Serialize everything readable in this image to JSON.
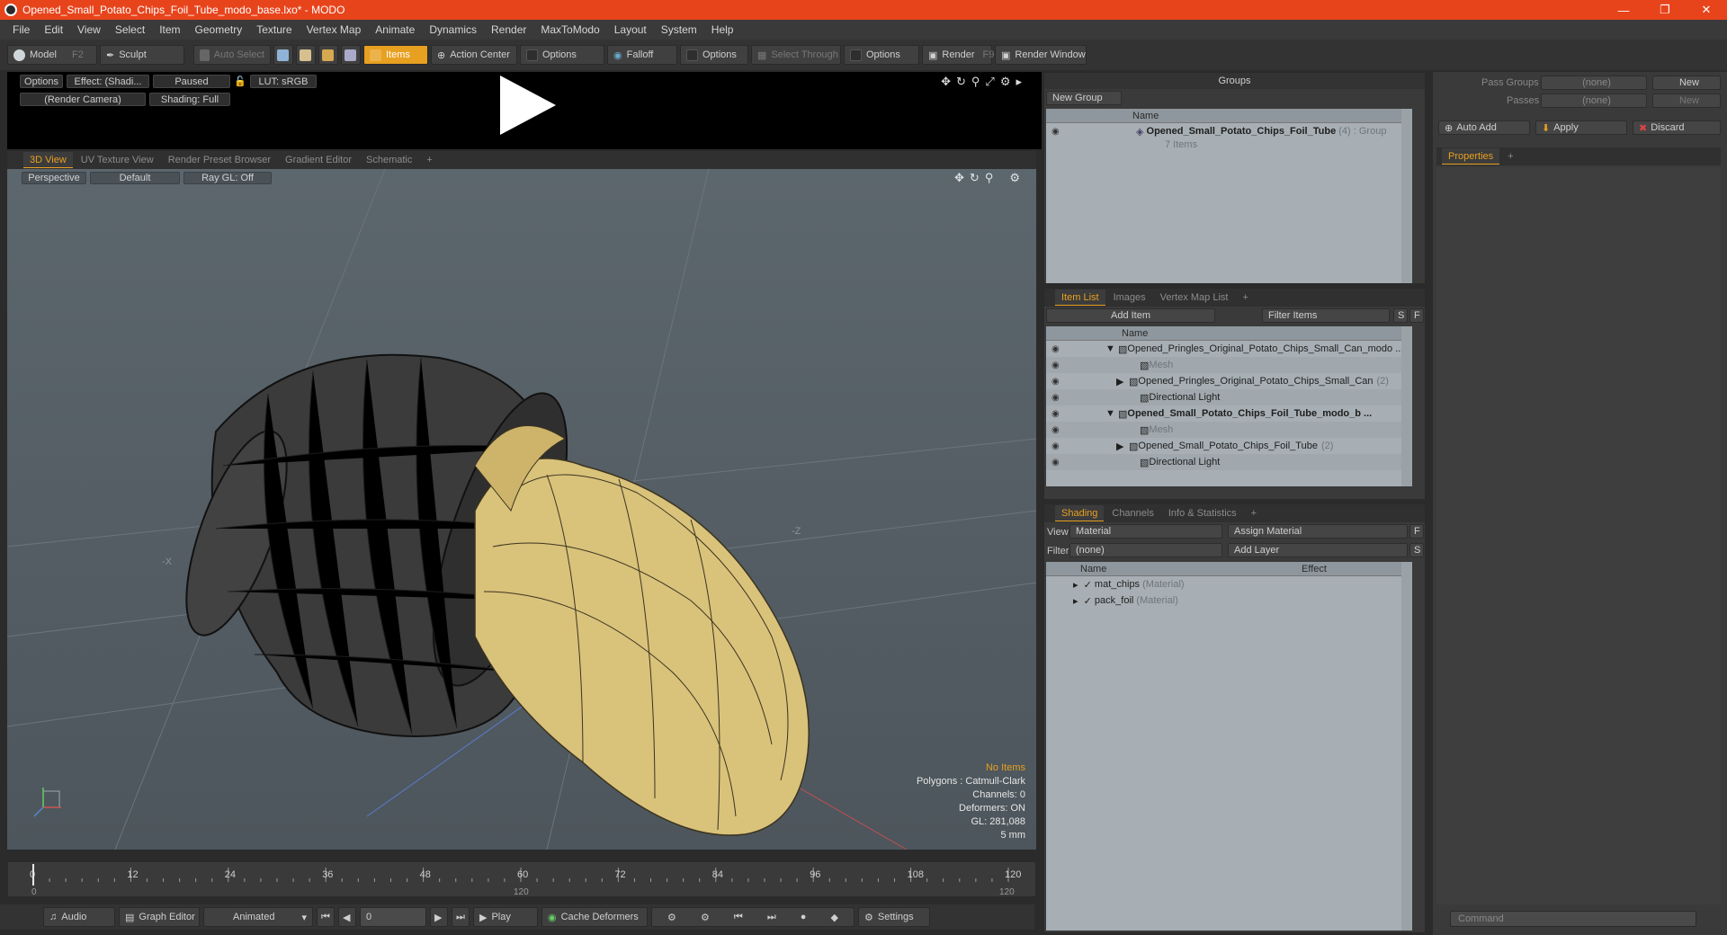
{
  "window": {
    "title": "Opened_Small_Potato_Chips_Foil_Tube_modo_base.lxo* - MODO"
  },
  "menu": [
    "File",
    "Edit",
    "View",
    "Select",
    "Item",
    "Geometry",
    "Texture",
    "Vertex Map",
    "Animate",
    "Dynamics",
    "Render",
    "MaxToModo",
    "Layout",
    "System",
    "Help"
  ],
  "toolbar": {
    "model": "Model",
    "model_key": "F2",
    "sculpt": "Sculpt",
    "auto_select": "Auto Select",
    "items": "Items",
    "action_center": "Action Center",
    "options1": "Options",
    "falloff": "Falloff",
    "options2": "Options",
    "select_through": "Select Through",
    "options3": "Options",
    "render": "Render",
    "render_key": "F9",
    "render_window": "Render Window"
  },
  "preview": {
    "options": "Options",
    "effect": "Effect: (Shadi...",
    "paused": "Paused",
    "lut": "LUT: sRGB",
    "camera": "(Render Camera)",
    "shading": "Shading: Full"
  },
  "view_tabs": [
    "3D View",
    "UV Texture View",
    "Render Preset Browser",
    "Gradient Editor",
    "Schematic",
    "+"
  ],
  "viewport": {
    "perspective": "Perspective",
    "default": "Default",
    "raygl": "Ray GL: Off",
    "info": {
      "no_items": "No Items",
      "polygons": "Polygons : Catmull-Clark",
      "channels": "Channels: 0",
      "deformers": "Deformers: ON",
      "gl": "GL: 281,088",
      "unit": "5 mm"
    },
    "axis_x": "X",
    "axis_z": "Z",
    "axis_mx": "-X",
    "axis_mz": "-Z"
  },
  "timeline": {
    "ticks": [
      "0",
      "12",
      "24",
      "36",
      "48",
      "60",
      "72",
      "84",
      "96",
      "108",
      "120"
    ],
    "low": "0",
    "mid": "120",
    "high": "120"
  },
  "bottom": {
    "audio": "Audio",
    "graph_editor": "Graph Editor",
    "animated": "Animated",
    "frame": "0",
    "play": "Play",
    "cache": "Cache Deformers",
    "settings": "Settings"
  },
  "groups": {
    "header": "Groups",
    "new_group": "New Group",
    "col_name": "Name",
    "row_name": "Opened_Small_Potato_Chips_Foil_Tube",
    "row_count": "(4)",
    "row_type": ": Group",
    "row_sub": "7 Items"
  },
  "itemlist": {
    "tabs": [
      "Item List",
      "Images",
      "Vertex Map List",
      "+"
    ],
    "add_item": "Add Item",
    "filter": "Filter Items",
    "s": "S",
    "f": "F",
    "col_name": "Name",
    "rows": [
      {
        "label": "Opened_Pringles_Original_Potato_Chips_Small_Can_modo ...",
        "count": "",
        "style": "normal",
        "indent": 0,
        "arrow": "▼"
      },
      {
        "label": "Mesh",
        "count": "",
        "style": "grey",
        "indent": 2,
        "arrow": ""
      },
      {
        "label": "Opened_Pringles_Original_Potato_Chips_Small_Can",
        "count": "(2)",
        "style": "normal",
        "indent": 1,
        "arrow": "▶"
      },
      {
        "label": "Directional Light",
        "count": "",
        "style": "normal",
        "indent": 2,
        "arrow": ""
      },
      {
        "label": "Opened_Small_Potato_Chips_Foil_Tube_modo_b ...",
        "count": "",
        "style": "bold",
        "indent": 0,
        "arrow": "▼"
      },
      {
        "label": "Mesh",
        "count": "",
        "style": "grey",
        "indent": 2,
        "arrow": ""
      },
      {
        "label": "Opened_Small_Potato_Chips_Foil_Tube",
        "count": "(2)",
        "style": "normal",
        "indent": 1,
        "arrow": "▶"
      },
      {
        "label": "Directional Light",
        "count": "",
        "style": "normal",
        "indent": 2,
        "arrow": ""
      }
    ]
  },
  "shading": {
    "tabs": [
      "Shading",
      "Channels",
      "Info & Statistics",
      "+"
    ],
    "view_label": "View",
    "view_value": "Material",
    "assign": "Assign Material",
    "f": "F",
    "filter_label": "Filter",
    "filter_value": "(none)",
    "add_layer": "Add Layer",
    "s": "S",
    "col_name": "Name",
    "col_effect": "Effect",
    "rows": [
      {
        "name": "mat_chips",
        "type": "(Material)"
      },
      {
        "name": "pack_foil",
        "type": "(Material)"
      }
    ]
  },
  "right": {
    "pass_groups": "Pass Groups",
    "pass_groups_val": "(none)",
    "new1": "New",
    "passes": "Passes",
    "passes_val": "(none)",
    "new2": "New",
    "auto_add": "Auto Add",
    "apply": "Apply",
    "discard": "Discard",
    "properties": "Properties",
    "plus": "+",
    "command": "Command"
  },
  "colors": {
    "accent": "#e8a020",
    "title": "#e8441c",
    "chips": "#d9c27a"
  }
}
